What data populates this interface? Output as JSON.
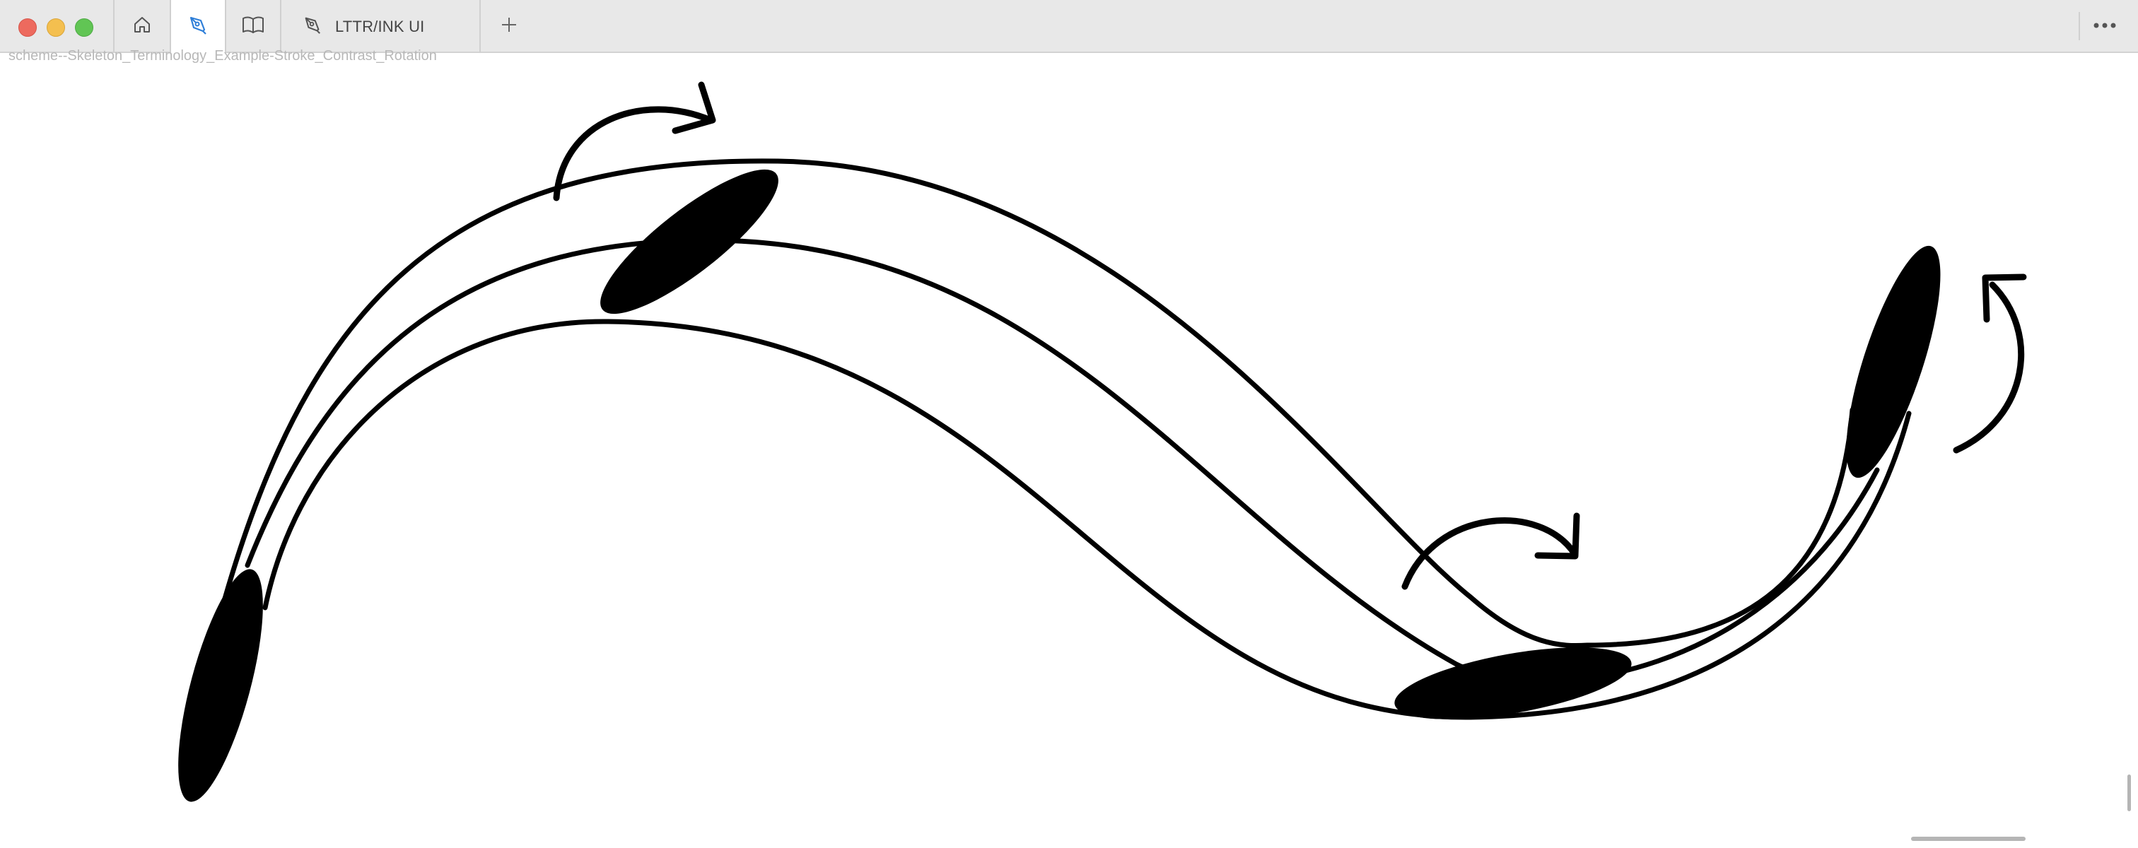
{
  "window": {
    "traffic_lights": [
      "close",
      "minimize",
      "zoom"
    ]
  },
  "tabs": [
    {
      "icon": "home-icon"
    },
    {
      "icon": "pen-nib-icon",
      "active": true,
      "accent": "#2f7fd8"
    },
    {
      "icon": "book-icon"
    },
    {
      "icon": "pen-nib-icon",
      "label": "LTTR/INK UI"
    }
  ],
  "toolbar": {
    "new_tab_icon": "plus-icon",
    "more_icon": "ellipsis-icon"
  },
  "document": {
    "filename": "scheme--Skeleton_Terminology_Example-Stroke_Contrast_Rotation"
  },
  "colors": {
    "ink": "#000000",
    "titlebar": "#e8e8e8",
    "accent": "#2f7fd8"
  }
}
